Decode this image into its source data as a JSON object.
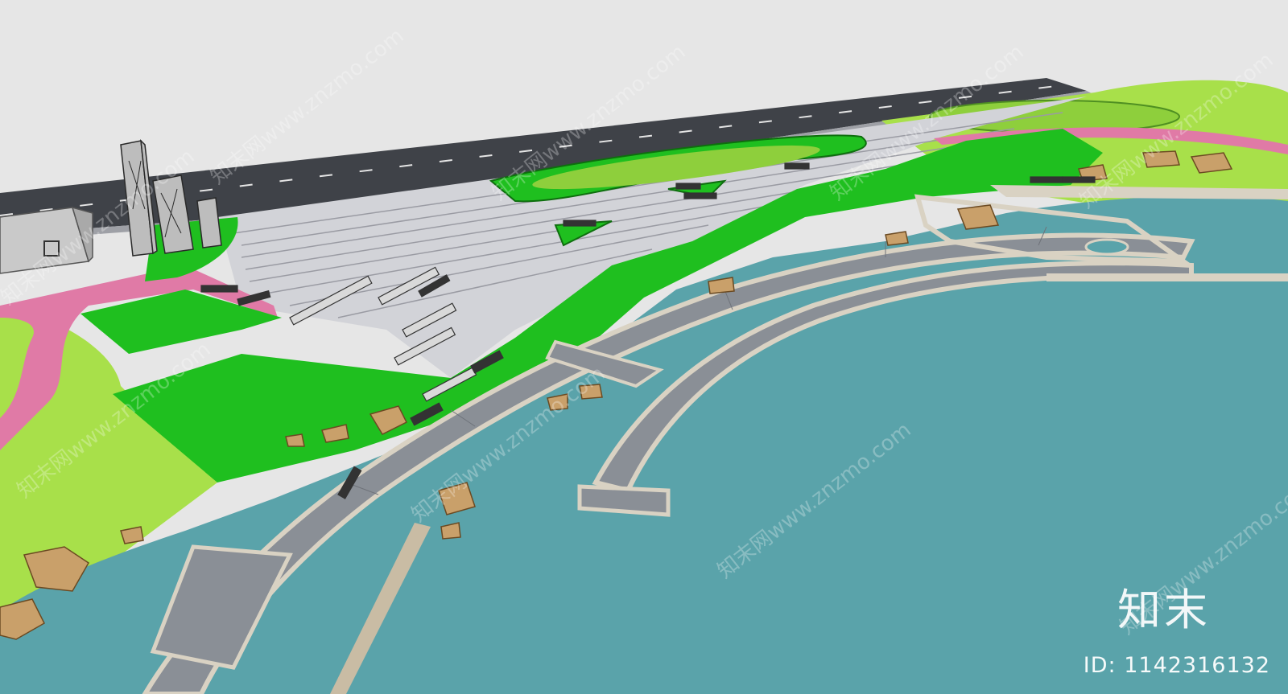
{
  "watermark": {
    "logo_text": "知末",
    "id_text": "ID: 1142316132",
    "repeat_text": "知末网www.znzmo.com"
  },
  "colors": {
    "sky": "#e6e6e6",
    "road": "#3f4248",
    "plaza": "#d2d3d8",
    "plaza_lines": "#9a9ba3",
    "lawn": "#1fbf1f",
    "lawn_light": "#a8e04a",
    "path_pink": "#e07aa6",
    "water": "#5aa3aa",
    "promenade": "#8a8f96",
    "railing": "#d9d2c3",
    "rock": "#c9a06a",
    "building": "#c9c9c9"
  }
}
